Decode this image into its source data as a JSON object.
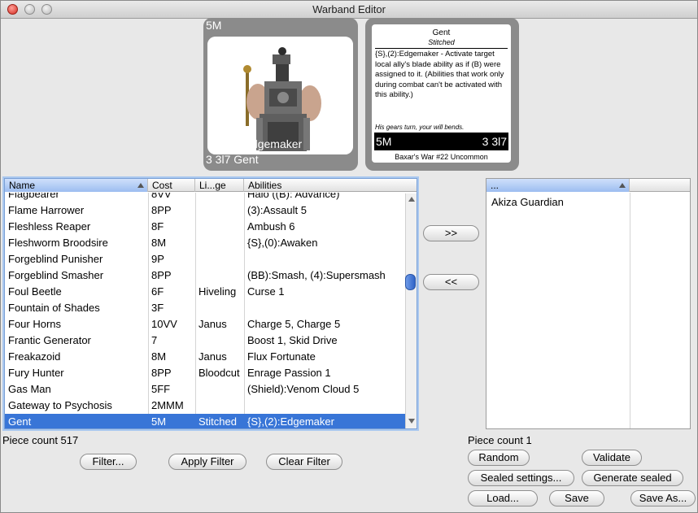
{
  "window": {
    "title": "Warband Editor"
  },
  "card_preview": {
    "cost": "5M",
    "ability": "{S},(2):Edgemaker",
    "stats_name": "3 3l7 Gent"
  },
  "card_detail": {
    "name": "Gent",
    "liege": "Stitched",
    "text": "{S},(2):Edgemaker - Activate target local ally's blade ability as if (B) were assigned to it. (Abilities that work only during combat can't be activated with this ability.)",
    "flavor": "His gears turn, your will bends.",
    "cost": "5M",
    "stats": "3 3l7",
    "footer": "Baxar's War  #22  Uncommon"
  },
  "pieces_table": {
    "columns": [
      "Name",
      "Cost",
      "Li...ge",
      "Abilities"
    ],
    "rows": [
      {
        "name": "Flagbearer",
        "cost": "8VV",
        "liege": "",
        "abilities": "Halo ((B): Advance)"
      },
      {
        "name": "Flame Harrower",
        "cost": "8PP",
        "liege": "",
        "abilities": "(3):Assault 5"
      },
      {
        "name": "Fleshless Reaper",
        "cost": "8F",
        "liege": "",
        "abilities": "Ambush 6"
      },
      {
        "name": "Fleshworm Broodsire",
        "cost": "8M",
        "liege": "",
        "abilities": "{S},(0):Awaken"
      },
      {
        "name": "Forgeblind Punisher",
        "cost": "9P",
        "liege": "",
        "abilities": ""
      },
      {
        "name": "Forgeblind Smasher",
        "cost": "8PP",
        "liege": "",
        "abilities": "(BB):Smash, (4):Supersmash"
      },
      {
        "name": "Foul Beetle",
        "cost": "6F",
        "liege": "Hiveling",
        "abilities": "Curse 1"
      },
      {
        "name": "Fountain of Shades",
        "cost": "3F",
        "liege": "",
        "abilities": ""
      },
      {
        "name": "Four Horns",
        "cost": "10VV",
        "liege": "Janus",
        "abilities": "Charge 5, Charge 5"
      },
      {
        "name": "Frantic Generator",
        "cost": "7",
        "liege": "",
        "abilities": "Boost 1, Skid Drive"
      },
      {
        "name": "Freakazoid",
        "cost": "8M",
        "liege": "Janus",
        "abilities": "Flux Fortunate"
      },
      {
        "name": "Fury Hunter",
        "cost": "8PP",
        "liege": "Bloodcut",
        "abilities": "Enrage Passion 1"
      },
      {
        "name": "Gas Man",
        "cost": "5FF",
        "liege": "",
        "abilities": "(Shield):Venom Cloud 5"
      },
      {
        "name": "Gateway to Psychosis",
        "cost": "2MMM",
        "liege": "",
        "abilities": ""
      },
      {
        "name": "Gent",
        "cost": "5M",
        "liege": "Stitched",
        "abilities": "{S},(2):Edgemaker"
      }
    ],
    "piece_count": "Piece count 517"
  },
  "warband_table": {
    "columns": [
      "..."
    ],
    "rows": [
      "Akiza Guardian"
    ],
    "piece_count": "Piece count 1"
  },
  "buttons": {
    "add": ">>",
    "remove": "<<",
    "filter": "Filter...",
    "apply_filter": "Apply Filter",
    "clear_filter": "Clear Filter",
    "random": "Random",
    "validate": "Validate",
    "sealed_settings": "Sealed settings...",
    "generate_sealed": "Generate sealed",
    "load": "Load...",
    "save": "Save",
    "save_as": "Save As..."
  }
}
